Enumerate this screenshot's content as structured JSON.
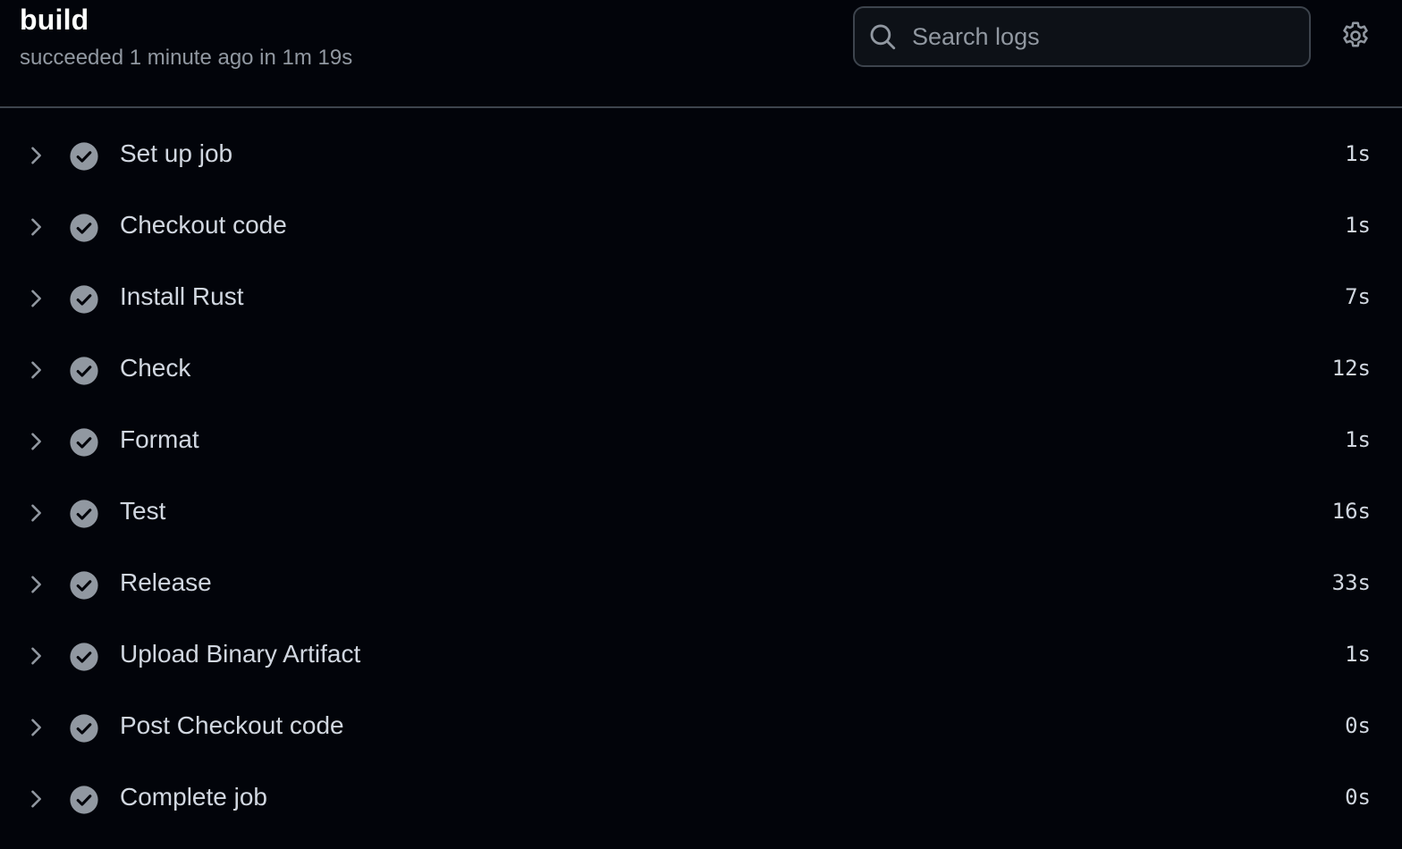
{
  "job": {
    "title": "build",
    "subtitle": "succeeded 1 minute ago in 1m 19s"
  },
  "search": {
    "placeholder": "Search logs",
    "value": ""
  },
  "icons": {
    "search": "search-icon",
    "settings": "gear-icon",
    "expand": "chevron-right-icon",
    "status": "check-circle-icon"
  },
  "colors": {
    "background": "#02040a",
    "divider": "#3d444d",
    "success_icon": "#9198a1",
    "text_muted": "#9198a1",
    "text_primary": "#d1d7e0"
  },
  "steps": [
    {
      "name": "Set up job",
      "duration": "1s",
      "status": "succeeded"
    },
    {
      "name": "Checkout code",
      "duration": "1s",
      "status": "succeeded"
    },
    {
      "name": "Install Rust",
      "duration": "7s",
      "status": "succeeded"
    },
    {
      "name": "Check",
      "duration": "12s",
      "status": "succeeded"
    },
    {
      "name": "Format",
      "duration": "1s",
      "status": "succeeded"
    },
    {
      "name": "Test",
      "duration": "16s",
      "status": "succeeded"
    },
    {
      "name": "Release",
      "duration": "33s",
      "status": "succeeded"
    },
    {
      "name": "Upload Binary Artifact",
      "duration": "1s",
      "status": "succeeded"
    },
    {
      "name": "Post Checkout code",
      "duration": "0s",
      "status": "succeeded"
    },
    {
      "name": "Complete job",
      "duration": "0s",
      "status": "succeeded"
    }
  ]
}
